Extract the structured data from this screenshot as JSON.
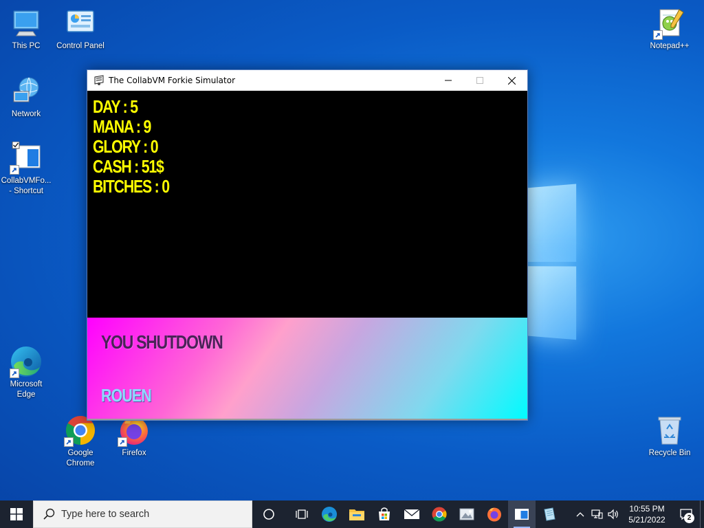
{
  "desktop": {
    "icons": [
      {
        "label": "This PC",
        "icon": "this-pc-icon"
      },
      {
        "label": "Control Panel",
        "icon": "control-panel-icon"
      },
      {
        "label": "Network",
        "icon": "network-icon"
      },
      {
        "label": "CollabVMFo... - Shortcut",
        "icon": "collabvm-shortcut-icon"
      },
      {
        "label": "Microsoft Edge",
        "icon": "edge-icon"
      },
      {
        "label": "Google Chrome",
        "icon": "chrome-icon"
      },
      {
        "label": "Firefox",
        "icon": "firefox-icon"
      },
      {
        "label": "Notepad++",
        "icon": "notepad-plus-plus-icon"
      },
      {
        "label": "Recycle Bin",
        "icon": "recycle-bin-icon"
      }
    ]
  },
  "window": {
    "title": "The CollabVM Forkie Simulator",
    "stats": [
      "DAY : 5",
      "MANA : 9",
      "GLORY : 0",
      "CASH : 51$",
      "BITCHES : 0"
    ],
    "event": {
      "title": "YOU SHUTDOWN",
      "name": "ROUEN"
    },
    "colors": {
      "stats_text": "#ffff00",
      "game_bg": "#000000"
    }
  },
  "taskbar": {
    "search_placeholder": "Type here to search",
    "apps": [
      "cortana-icon",
      "task-view-icon",
      "edge-icon",
      "file-explorer-icon",
      "store-icon",
      "mail-icon",
      "chrome-icon",
      "photos-icon",
      "firefox-icon",
      "forkie-simulator-icon",
      "notepad-icon"
    ],
    "clock": {
      "time": "10:55 PM",
      "date": "5/21/2022"
    },
    "notification_count": "2"
  }
}
